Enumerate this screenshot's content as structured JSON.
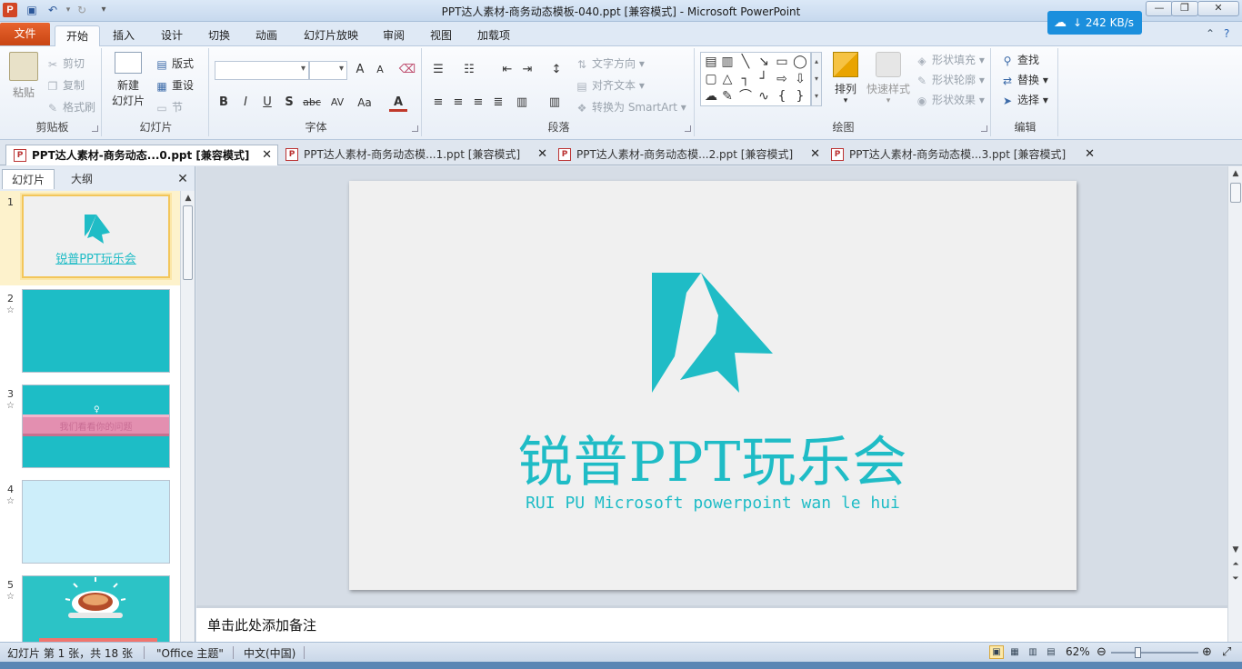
{
  "window": {
    "title": "PPT达人素材-商务动态模板-040.ppt [兼容模式] - Microsoft PowerPoint",
    "speed": "242 KB/s"
  },
  "ribbon_tabs": [
    "文件",
    "开始",
    "插入",
    "设计",
    "切换",
    "动画",
    "幻灯片放映",
    "审阅",
    "视图",
    "加载项"
  ],
  "clipboard": {
    "paste": "粘贴",
    "cut": "剪切",
    "copy": "复制",
    "format_painter": "格式刷",
    "label": "剪贴板"
  },
  "slides_group": {
    "new_slide": "新建",
    "new_slide_2": "幻灯片",
    "layout": "版式",
    "reset": "重设",
    "section": "节",
    "label": "幻灯片"
  },
  "font_group": {
    "label": "字体",
    "grow": "A",
    "shrink": "A",
    "bold": "B",
    "italic": "I",
    "underline": "U",
    "shadow": "S",
    "strike": "abc",
    "spacing": "AV",
    "case": "Aa",
    "color": "A"
  },
  "paragraph_group": {
    "label": "段落",
    "text_direction": "文字方向",
    "align_text": "对齐文本",
    "smartart": "转换为 SmartArt"
  },
  "drawing_group": {
    "label": "绘图",
    "arrange": "排列",
    "quick_styles": "快速样式",
    "shape_fill": "形状填充",
    "shape_outline": "形状轮廓",
    "shape_effects": "形状效果"
  },
  "editing_group": {
    "label": "编辑",
    "find": "查找",
    "replace": "替换",
    "select": "选择"
  },
  "doc_tabs": [
    "PPT达人素材-商务动态...0.ppt [兼容模式]",
    "PPT达人素材-商务动态模...1.ppt [兼容模式]",
    "PPT达人素材-商务动态模...2.ppt [兼容模式]",
    "PPT达人素材-商务动态模...3.ppt [兼容模式]"
  ],
  "left_panel": {
    "tab_slides": "幻灯片",
    "tab_outline": "大纲",
    "thumbs": [
      {
        "num": "1",
        "star": "",
        "title": "锐普PPT玩乐会",
        "bg": "#f0f0f0"
      },
      {
        "num": "2",
        "star": "☆",
        "bg": "#1dbdc6"
      },
      {
        "num": "3",
        "star": "☆",
        "bg": "#1dbdc6",
        "band_text": "我们看看你的问题"
      },
      {
        "num": "4",
        "star": "☆",
        "bg": "#cdeefa"
      },
      {
        "num": "5",
        "star": "☆",
        "bg": "#2cc3c6"
      }
    ]
  },
  "slide": {
    "title": "锐普PPT玩乐会",
    "subtitle": "RUI PU Microsoft powerpoint wan le hui",
    "accent": "#1fbcc6"
  },
  "notes": {
    "placeholder": "单击此处添加备注"
  },
  "status": {
    "slide_info": "幻灯片 第 1 张，共 18 张",
    "theme": "\"Office 主题\"",
    "language": "中文(中国)",
    "zoom": "62%"
  }
}
